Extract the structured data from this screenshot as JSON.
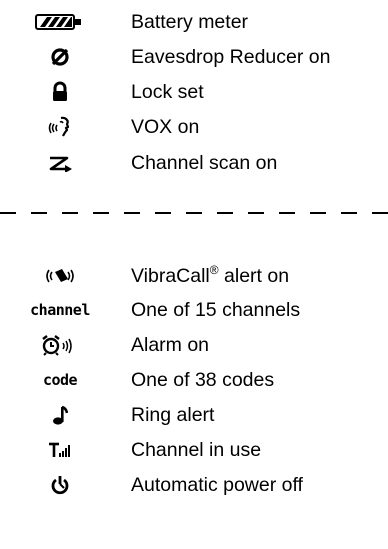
{
  "section_top": {
    "items": [
      {
        "icon": "battery-icon",
        "label": "Battery meter"
      },
      {
        "icon": "eavesdrop-reducer-icon",
        "label": "Eavesdrop Reducer on"
      },
      {
        "icon": "lock-icon",
        "label": "Lock set"
      },
      {
        "icon": "vox-icon",
        "label": "VOX on"
      },
      {
        "icon": "channel-scan-icon",
        "label": "Channel scan on"
      }
    ]
  },
  "section_bottom": {
    "items": [
      {
        "icon": "vibracall-icon",
        "label": "VibraCall",
        "registered": "®",
        "label_suffix": " alert on"
      },
      {
        "icon": "channel-word-icon",
        "icon_text": "channel",
        "label": "One of 15 channels"
      },
      {
        "icon": "alarm-icon",
        "label": "Alarm on"
      },
      {
        "icon": "code-word-icon",
        "icon_text": "code",
        "label": "One of 38 codes"
      },
      {
        "icon": "ring-alert-icon",
        "label": "Ring alert"
      },
      {
        "icon": "channel-in-use-icon",
        "label": "Channel in use"
      },
      {
        "icon": "auto-power-off-icon",
        "label": "Automatic power off"
      }
    ]
  }
}
